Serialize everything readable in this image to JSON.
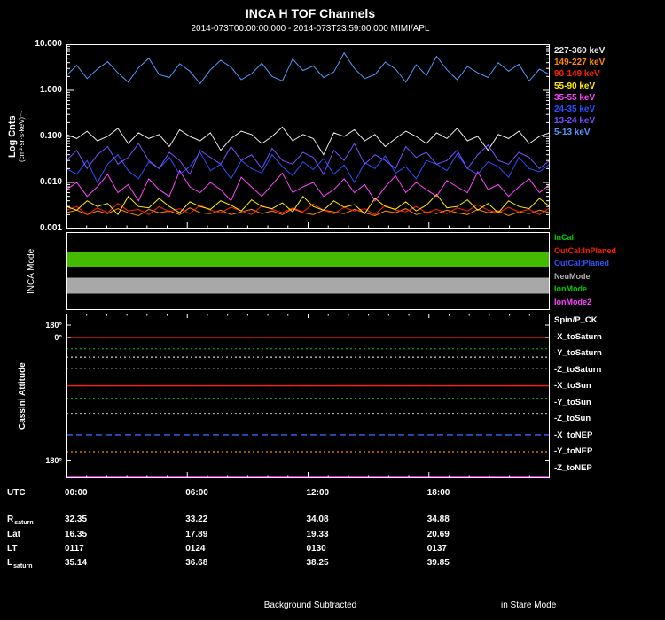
{
  "header": {
    "title": "INCA H TOF Channels",
    "subtitle": "2014-073T00:00:00.000 - 2014-073T23:59:00.000 MIMI/APL"
  },
  "labels": {
    "counts_ylabel": "Log Cnts",
    "counts_yunits": "(cm²·sr·s·keV)⁻¹",
    "mode_ylabel": "INCA Mode",
    "attitude_ylabel": "Cassini Attitude"
  },
  "axis": {
    "x_axis_label": "UTC",
    "x_ticks": [
      {
        "label": "00:00",
        "frac": 0
      },
      {
        "label": "06:00",
        "frac": 0.25
      },
      {
        "label": "12:00",
        "frac": 0.5
      },
      {
        "label": "18:00",
        "frac": 0.75
      }
    ],
    "counts_yticks": [
      "10.000",
      "1.000",
      "0.100",
      "0.010",
      "0.001"
    ],
    "attitude_yticks": [
      {
        "label": "180°",
        "frac": 0.07
      },
      {
        "label": "0°",
        "frac": 0.145
      },
      {
        "label": "180°",
        "frac": 0.89
      }
    ]
  },
  "legends": {
    "modes": [
      {
        "label": "InCal",
        "color": "#00cc00"
      },
      {
        "label": "OutCal:InPlaned",
        "color": "#ff2200"
      },
      {
        "label": "OutCal:Planed",
        "color": "#3355ff"
      },
      {
        "label": "NeuMode",
        "color": "#b0b0b0"
      },
      {
        "label": "IonMode",
        "color": "#00cc00"
      },
      {
        "label": "IonMode2",
        "color": "#ff44ff"
      }
    ]
  },
  "chart_data": [
    {
      "type": "line",
      "title": "INCA H TOF Channels",
      "xlabel": "UTC",
      "ylabel": "Log Cnts (cm²·sr·s·keV)⁻¹",
      "yscale": "log",
      "ylim": [
        0.001,
        10
      ],
      "x_start_hour": 0,
      "x_end_hour": 24,
      "n_points": 48,
      "xticks": [
        "00:00",
        "06:00",
        "12:00",
        "18:00"
      ],
      "legend_position": "right",
      "background": "#000000",
      "series": [
        {
          "name": "227-360 keV",
          "color": "#e8e8e8",
          "values": [
            0.11,
            0.09,
            0.13,
            0.08,
            0.1,
            0.15,
            0.07,
            0.12,
            0.09,
            0.11,
            0.06,
            0.14,
            0.1,
            0.08,
            0.12,
            0.05,
            0.09,
            0.13,
            0.11,
            0.07,
            0.1,
            0.16,
            0.08,
            0.11,
            0.09,
            0.04,
            0.12,
            0.1,
            0.14,
            0.08,
            0.11,
            0.06,
            0.09,
            0.13,
            0.1,
            0.07,
            0.12,
            0.09,
            0.15,
            0.08,
            0.1,
            0.05,
            0.11,
            0.09,
            0.13,
            0.07,
            0.1,
            0.12
          ]
        },
        {
          "name": "149-227 keV",
          "color": "#ff8800",
          "values": [
            0.0022,
            0.0025,
            0.002,
            0.0024,
            0.0021,
            0.0027,
            0.0022,
            0.0019,
            0.0026,
            0.0022,
            0.0024,
            0.002,
            0.0028,
            0.0022,
            0.0021,
            0.0025,
            0.002,
            0.0023,
            0.0026,
            0.0021,
            0.0024,
            0.002,
            0.0027,
            0.0022,
            0.002,
            0.0025,
            0.0023,
            0.0021,
            0.0026,
            0.0022,
            0.0019,
            0.0024,
            0.0022,
            0.0027,
            0.002,
            0.0023,
            0.0021,
            0.0025,
            0.0022,
            0.002,
            0.0026,
            0.0022,
            0.0024,
            0.0019,
            0.0023,
            0.0021,
            0.0025,
            0.0022
          ]
        },
        {
          "name": "90-149 keV",
          "color": "#ff2200",
          "values": [
            0.0025,
            0.003,
            0.002,
            0.0028,
            0.0022,
            0.0035,
            0.0024,
            0.0026,
            0.002,
            0.003,
            0.0023,
            0.0027,
            0.0021,
            0.0032,
            0.0025,
            0.0022,
            0.0029,
            0.0024,
            0.002,
            0.0031,
            0.0026,
            0.0022,
            0.0028,
            0.0023,
            0.0034,
            0.0025,
            0.0021,
            0.0029,
            0.0024,
            0.0027,
            0.002,
            0.0032,
            0.0025,
            0.0023,
            0.003,
            0.0022,
            0.0026,
            0.0021,
            0.0028,
            0.0024,
            0.0033,
            0.0025,
            0.0022,
            0.0029,
            0.0023,
            0.0026,
            0.002,
            0.0028
          ]
        },
        {
          "name": "55-90 keV",
          "color": "#ffee00",
          "values": [
            0.003,
            0.0025,
            0.004,
            0.003,
            0.0035,
            0.002,
            0.005,
            0.003,
            0.0028,
            0.0045,
            0.003,
            0.0022,
            0.0038,
            0.003,
            0.0026,
            0.004,
            0.0032,
            0.0024,
            0.0042,
            0.003,
            0.0027,
            0.0036,
            0.0023,
            0.005,
            0.003,
            0.0025,
            0.004,
            0.0029,
            0.0033,
            0.0021,
            0.0045,
            0.003,
            0.0026,
            0.0038,
            0.0024,
            0.0032,
            0.0055,
            0.0028,
            0.003,
            0.0042,
            0.0025,
            0.0035,
            0.0022,
            0.004,
            0.003,
            0.0027,
            0.0045,
            0.003
          ]
        },
        {
          "name": "35-55 keV",
          "color": "#ff44ff",
          "values": [
            0.007,
            0.01,
            0.005,
            0.008,
            0.015,
            0.006,
            0.009,
            0.004,
            0.012,
            0.007,
            0.005,
            0.018,
            0.008,
            0.006,
            0.01,
            0.007,
            0.004,
            0.013,
            0.008,
            0.005,
            0.009,
            0.016,
            0.006,
            0.008,
            0.01,
            0.005,
            0.007,
            0.012,
            0.006,
            0.009,
            0.004,
            0.008,
            0.014,
            0.006,
            0.01,
            0.007,
            0.005,
            0.011,
            0.008,
            0.006,
            0.017,
            0.007,
            0.009,
            0.005,
            0.008,
            0.012,
            0.006,
            0.009
          ]
        },
        {
          "name": "24-35 keV",
          "color": "#2b50ff",
          "values": [
            0.02,
            0.015,
            0.03,
            0.01,
            0.025,
            0.04,
            0.018,
            0.012,
            0.028,
            0.02,
            0.035,
            0.015,
            0.022,
            0.045,
            0.018,
            0.025,
            0.012,
            0.03,
            0.02,
            0.016,
            0.04,
            0.022,
            0.014,
            0.028,
            0.019,
            0.033,
            0.015,
            0.024,
            0.01,
            0.027,
            0.02,
            0.038,
            0.016,
            0.022,
            0.012,
            0.03,
            0.025,
            0.018,
            0.042,
            0.02,
            0.015,
            0.028,
            0.022,
            0.013,
            0.035,
            0.02,
            0.017,
            0.025
          ]
        },
        {
          "name": "13-24 keV",
          "color": "#7a4fff",
          "values": [
            0.03,
            0.05,
            0.02,
            0.04,
            0.06,
            0.025,
            0.035,
            0.07,
            0.03,
            0.02,
            0.045,
            0.03,
            0.015,
            0.05,
            0.035,
            0.025,
            0.06,
            0.03,
            0.04,
            0.02,
            0.055,
            0.03,
            0.025,
            0.045,
            0.035,
            0.015,
            0.05,
            0.03,
            0.07,
            0.025,
            0.04,
            0.03,
            0.02,
            0.06,
            0.035,
            0.045,
            0.025,
            0.03,
            0.05,
            0.02,
            0.04,
            0.065,
            0.03,
            0.025,
            0.045,
            0.035,
            0.02,
            0.03
          ]
        },
        {
          "name": "5-13 keV",
          "color": "#5599ff",
          "values": [
            2.1,
            3.5,
            1.8,
            2.9,
            4.2,
            2.4,
            1.5,
            3.1,
            5.0,
            2.2,
            1.9,
            3.8,
            2.6,
            1.4,
            2.8,
            4.5,
            3.2,
            1.7,
            2.3,
            3.9,
            2.0,
            1.6,
            4.8,
            2.7,
            3.4,
            1.9,
            2.5,
            6.5,
            3.0,
            1.8,
            2.2,
            4.1,
            2.9,
            1.5,
            3.6,
            2.1,
            5.5,
            2.8,
            1.7,
            3.3,
            2.4,
            1.9,
            4.0,
            2.6,
            3.7,
            1.6,
            2.9,
            2.2
          ]
        }
      ]
    },
    {
      "type": "line",
      "title": "Cassini Attitude",
      "ylabel": "degrees",
      "ylim": [
        -180,
        180
      ],
      "xlim": [
        "00:00",
        "24:00"
      ],
      "series": [
        {
          "name": "Spin/P_CK",
          "color": "#ffffff",
          "style": "dotted",
          "width": 1,
          "value_deg": 85
        },
        {
          "name": "-X_toSaturn",
          "color": "#ff2200",
          "style": "solid",
          "width": 1.4,
          "value_deg": 128
        },
        {
          "name": "-Y_toSaturn",
          "color": "#00bb33",
          "style": "dotted",
          "width": 1,
          "value_deg": 103
        },
        {
          "name": "-Z_toSaturn",
          "color": "#999999",
          "style": "dotted",
          "width": 1,
          "value_deg": 60
        },
        {
          "name": "-X_toSun",
          "color": "#ff2200",
          "style": "solid",
          "width": 1.4,
          "value_deg": 22
        },
        {
          "name": "-Y_toSun",
          "color": "#00bb33",
          "style": "dotted",
          "width": 1,
          "value_deg": -5
        },
        {
          "name": "-Z_toSun",
          "color": "#bbbbbb",
          "style": "dotted",
          "width": 1,
          "value_deg": -38
        },
        {
          "name": "-X_toNEP",
          "color": "#3366ff",
          "style": "dashed",
          "width": 1.4,
          "value_deg": -85
        },
        {
          "name": "-Y_toNEP",
          "color": "#ff8800",
          "style": "dotted",
          "width": 1.2,
          "value_deg": -122
        },
        {
          "name": "-Z_toNEP",
          "color": "#ff00ff",
          "style": "solid",
          "width": 3,
          "value_deg": -177
        }
      ]
    },
    {
      "type": "table",
      "title": "INCA Mode",
      "rows": [
        {
          "mode": "IonMode",
          "color": "#44bb00",
          "start": "00:00",
          "end": "24:00",
          "lane_top_frac": 0.25,
          "lane_height_frac": 0.205
        },
        {
          "mode": "NeuMode",
          "color": "#a8a8a8",
          "start": "00:00",
          "end": "24:00",
          "lane_top_frac": 0.585,
          "lane_height_frac": 0.205
        }
      ]
    }
  ],
  "ephemeris": {
    "rows": [
      {
        "label": "R",
        "sub": "saturn",
        "values": [
          "32.35",
          "33.22",
          "34.08",
          "34.88"
        ]
      },
      {
        "label": "Lat",
        "sub": "",
        "values": [
          "16.35",
          "17.89",
          "19.33",
          "20.69"
        ]
      },
      {
        "label": "LT",
        "sub": "",
        "values": [
          "0117",
          "0124",
          "0130",
          "0137"
        ]
      },
      {
        "label": "L",
        "sub": "saturn",
        "values": [
          "35.14",
          "36.68",
          "38.25",
          "39.85"
        ]
      }
    ]
  },
  "footer": {
    "left": "Background Subtracted",
    "right": "in Stare Mode"
  },
  "colors": {
    "background": "#000000",
    "frame": "#ffffff",
    "text": "#ffffff"
  }
}
